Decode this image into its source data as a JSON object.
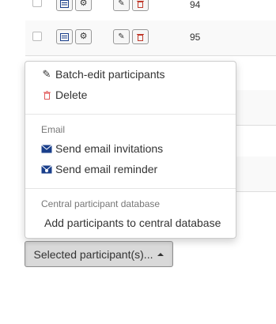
{
  "rows": [
    {
      "id": "94"
    },
    {
      "id": "95"
    }
  ],
  "menu": {
    "batch_edit": "Batch-edit participants",
    "delete": "Delete",
    "email_header": "Email",
    "send_invitations": "Send email invitations",
    "send_reminder": "Send email reminder",
    "central_header": "Central participant database",
    "add_central": "Add participants to central database"
  },
  "selected_button": {
    "label": "Selected participant(s)..."
  },
  "colors": {
    "delete_icon": "#e05a5a",
    "edit_icon": "#c0392b",
    "text": "#333333"
  }
}
